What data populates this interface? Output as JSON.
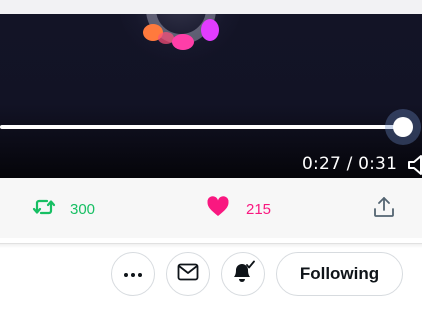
{
  "player": {
    "elapsed": "0:27",
    "duration": "0:31",
    "time_display": "0:27 / 0:31",
    "progress_fraction": 0.87
  },
  "stats": {
    "retweets": "300",
    "likes": "215"
  },
  "profile_actions": {
    "follow_label": "Following"
  },
  "colors": {
    "retweet_green": "#17bf63",
    "like_pink": "#f91880",
    "text_dark": "#0f1419",
    "border": "#d7dbdf"
  },
  "icons": [
    "retweet-icon",
    "heart-icon",
    "share-icon",
    "more-icon",
    "mail-icon",
    "bell-icon",
    "volume-icon"
  ]
}
